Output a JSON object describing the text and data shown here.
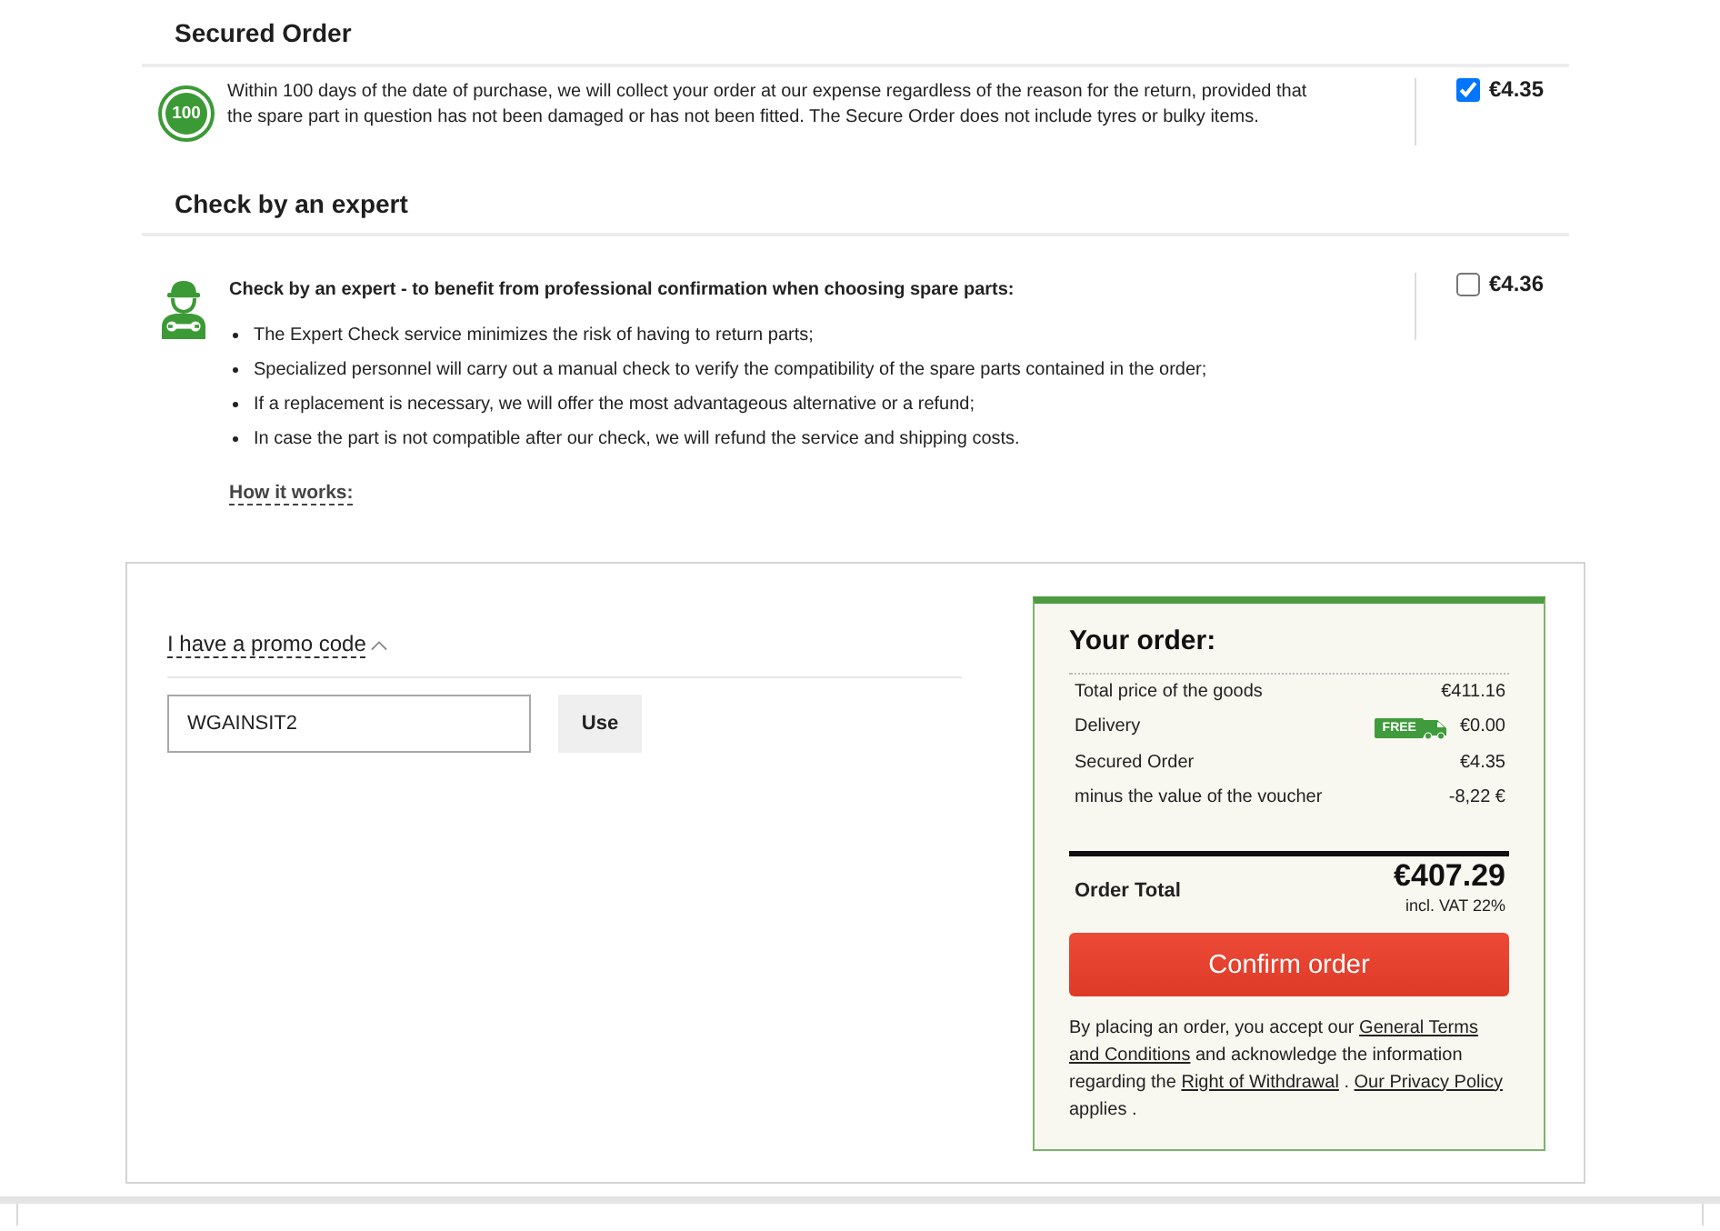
{
  "secured_order": {
    "title": "Secured Order",
    "badge": "100",
    "description": "Within 100 days of the date of purchase, we will collect your order at our expense regardless of the reason for the return, provided that the spare part in question has not been damaged or has not been fitted. The Secure Order does not include tyres or bulky items.",
    "checked": true,
    "price": "€4.35"
  },
  "expert_check": {
    "title": "Check by an expert",
    "lead": "Check by an expert - to benefit from professional confirmation when choosing spare parts:",
    "bullets": [
      "The Expert Check service minimizes the risk of having to return parts;",
      "Specialized personnel will carry out a manual check to verify the compatibility of the spare parts contained in the order;",
      "If a replacement is necessary, we will offer the most advantageous alternative or a refund;",
      "In case the part is not compatible after our check, we will refund the service and shipping costs."
    ],
    "link": "How it works:",
    "checked": false,
    "price": "€4.36"
  },
  "promo": {
    "toggle": "I have a promo code",
    "expanded": true,
    "value": "WGAINSIT2",
    "button": "Use"
  },
  "summary": {
    "title": "Your order:",
    "rows": [
      {
        "label": "Total price of the goods",
        "value": "€411.16"
      },
      {
        "label": "Delivery",
        "badge": "FREE",
        "value": "€0.00"
      },
      {
        "label": "Secured Order",
        "value": "€4.35"
      },
      {
        "label": "minus the value of the voucher",
        "value": "-8,22 €"
      }
    ],
    "total_label": "Order Total",
    "total": "€407.29",
    "vat": "incl. VAT 22%",
    "confirm": "Confirm order",
    "legal": [
      {
        "kind": "text",
        "text": "By placing an order, you accept our"
      },
      {
        "kind": "link",
        "text": "General Terms"
      },
      {
        "kind": "link",
        "text": "and Conditions"
      },
      {
        "kind": "text",
        "text": "and acknowledge the information regarding the"
      },
      {
        "kind": "link",
        "text": "Right of Withdrawal"
      },
      {
        "kind": "text",
        "text": "."
      },
      {
        "kind": "link",
        "text": "Our Privacy Policy"
      },
      {
        "kind": "text",
        "text": "applies ."
      }
    ]
  }
}
